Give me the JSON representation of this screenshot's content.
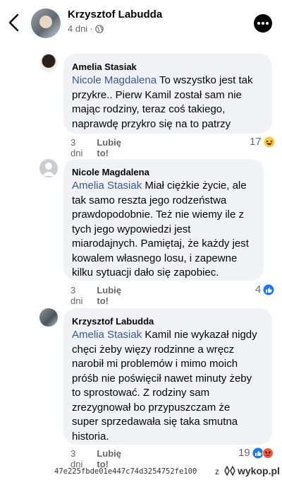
{
  "post": {
    "author": "Krzysztof Labudda",
    "time": "4 dni",
    "dot": "·"
  },
  "comments": [
    {
      "author": "Amelia Stasiak",
      "mention": "Nicole Magdalena",
      "lines": [
        " To wszystko jest tak",
        "przykre.. Pierw Kamil został sam nie",
        "mając rodziny, teraz coś takiego,",
        "naprawdę przykro się na to patrzy"
      ],
      "time": "3 dni",
      "like": "Lubię to!",
      "reactions": "17"
    },
    {
      "author": "Nicole Magdalena",
      "mention": "Amelia Stasiak",
      "lines": [
        " Miał ciężkie życie, ale",
        "tak samo reszta jego rodzeństwa",
        "prawdopodobnie. Też nie wiemy ile z",
        "tych jego wypowiedzi jest",
        "miarodajnych. Pamiętaj, że każdy jest",
        "kowalem własnego losu, i zapewne",
        "kilku sytuacji dało się zapobiec."
      ],
      "time": "3 dni",
      "like": "Lubię to!",
      "reactions": "4"
    },
    {
      "author": "Krzysztof Labudda",
      "mention": "Amelia Stasiak",
      "lines": [
        " Kamil nie wykazał nigdy",
        "chęci żeby więzy rodzinne a wręcz",
        "narobił mi problemów i mimo moich",
        "próśb nie poświęcił nawet minuty żeby",
        "to sprostować. Z rodziny sam",
        "zrezygnował bo przypuszczam że",
        "super sprzedawała się taka smutna",
        "historia."
      ],
      "time": "3 dni",
      "like": "Lubię to!",
      "reactions": "19"
    }
  ],
  "footer": {
    "hash": "47e225fbde01e447c74d3254752fe100",
    "z": "z",
    "brand": "wykop.pl"
  },
  "colors": {
    "mention": "#385898",
    "bubble": "#f0f2f5",
    "meta": "#65676b"
  }
}
